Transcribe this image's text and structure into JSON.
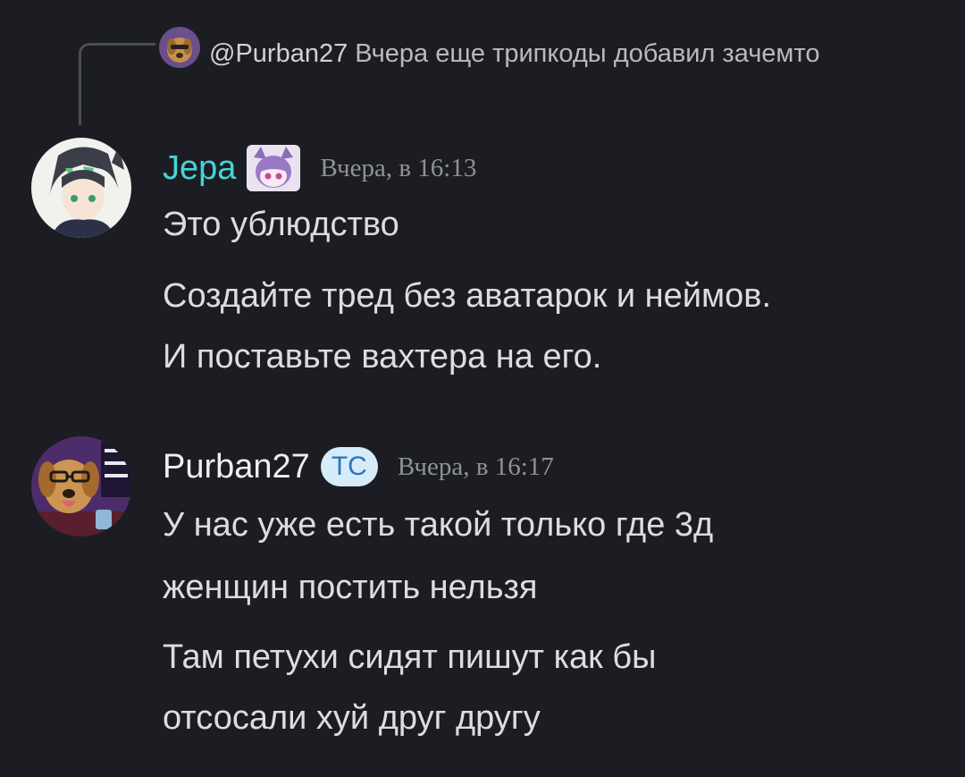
{
  "reply": {
    "author": "@Purban27",
    "text": "Вчера еще трипкоды добавил зачемто"
  },
  "messages": [
    {
      "username": "Jepa",
      "timestamp": "Вчера, в 16:13",
      "lines": [
        "Это ублюдство",
        "Создайте тред без аватарок и неймов.",
        "И поставьте вахтера на его."
      ]
    },
    {
      "username": "Purban27",
      "badge": "ТС",
      "timestamp": "Вчера, в 16:17",
      "lines": [
        "У нас уже есть такой только где 3д",
        "женщин постить нельзя",
        "Там петухи сидят пишут как бы",
        "отсосали хуй друг другу"
      ]
    }
  ],
  "colors": {
    "background": "#1c1d22",
    "jepa_name": "#45d4d6",
    "ts_badge_bg": "#d6ecfa",
    "ts_badge_text": "#2f74b8"
  }
}
